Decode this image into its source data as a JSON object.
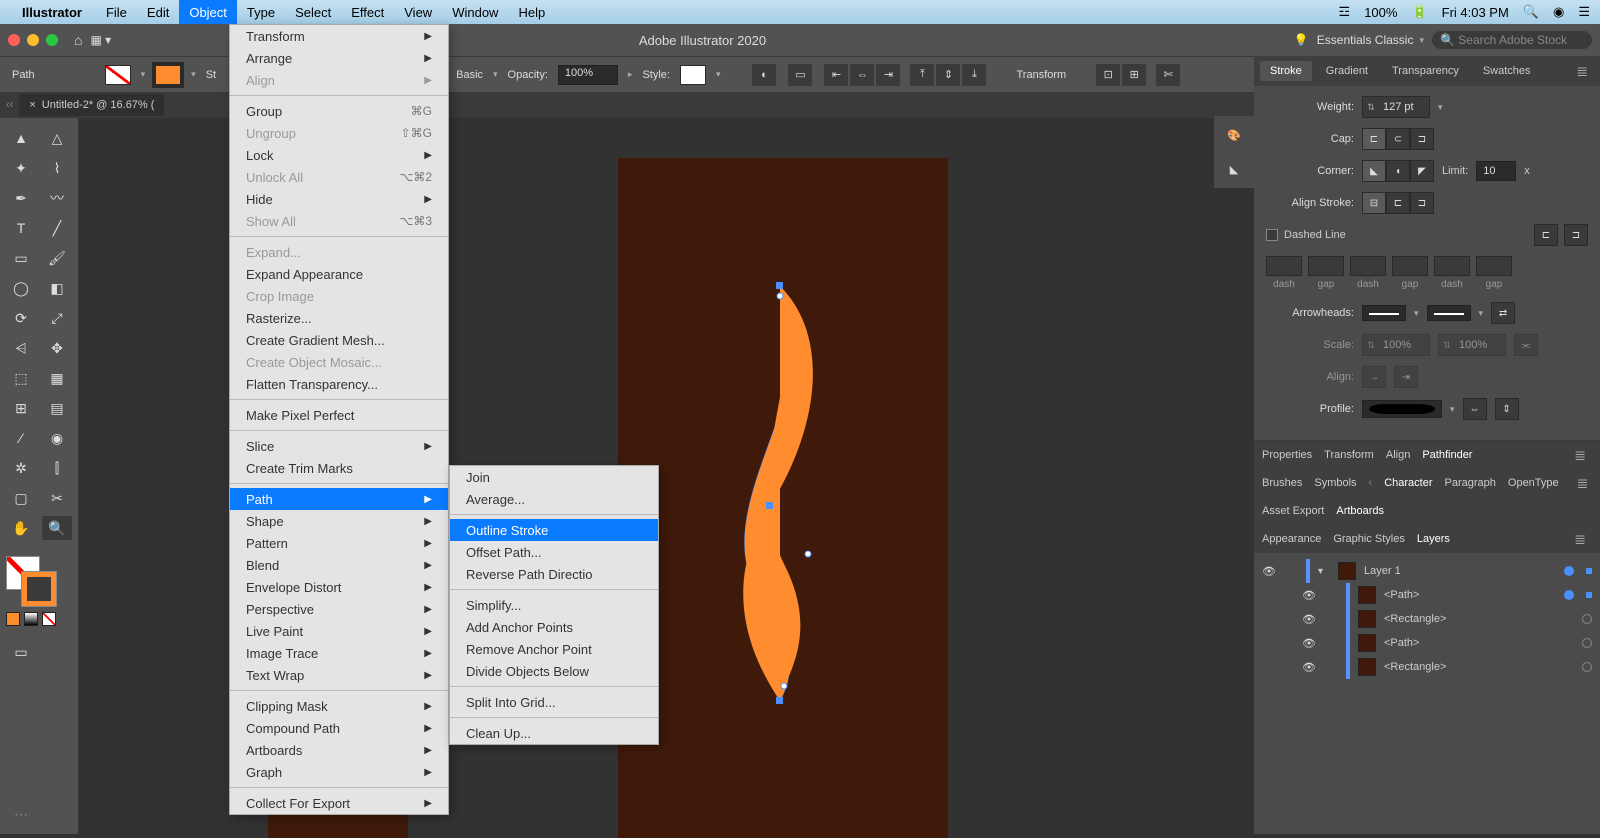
{
  "menubar": {
    "app": "Illustrator",
    "items": [
      "File",
      "Edit",
      "Object",
      "Type",
      "Select",
      "Effect",
      "View",
      "Window",
      "Help"
    ],
    "active_index": 2,
    "battery": "100%",
    "clock": "Fri 4:03 PM"
  },
  "appbar": {
    "title": "Adobe Illustrator 2020",
    "workspace": "Essentials Classic",
    "search_placeholder": "Search Adobe Stock"
  },
  "controlbar": {
    "selection_type": "Path",
    "stroke_label": "St",
    "basic_label": "Basic",
    "opacity_label": "Opacity:",
    "opacity_value": "100%",
    "style_label": "Style:",
    "transform_label": "Transform"
  },
  "tabbar": {
    "tab_title": "Untitled-2* @ 16.67% ("
  },
  "object_menu": [
    {
      "label": "Transform",
      "sub": true
    },
    {
      "label": "Arrange",
      "sub": true
    },
    {
      "label": "Align",
      "sub": true,
      "disabled": true
    },
    {
      "sep": true
    },
    {
      "label": "Group",
      "shortcut": "⌘G"
    },
    {
      "label": "Ungroup",
      "shortcut": "⇧⌘G",
      "disabled": true
    },
    {
      "label": "Lock",
      "sub": true
    },
    {
      "label": "Unlock All",
      "shortcut": "⌥⌘2",
      "disabled": true
    },
    {
      "label": "Hide",
      "sub": true
    },
    {
      "label": "Show All",
      "shortcut": "⌥⌘3",
      "disabled": true
    },
    {
      "sep": true
    },
    {
      "label": "Expand...",
      "disabled": true
    },
    {
      "label": "Expand Appearance"
    },
    {
      "label": "Crop Image",
      "disabled": true
    },
    {
      "label": "Rasterize..."
    },
    {
      "label": "Create Gradient Mesh..."
    },
    {
      "label": "Create Object Mosaic...",
      "disabled": true
    },
    {
      "label": "Flatten Transparency..."
    },
    {
      "sep": true
    },
    {
      "label": "Make Pixel Perfect"
    },
    {
      "sep": true
    },
    {
      "label": "Slice",
      "sub": true
    },
    {
      "label": "Create Trim Marks"
    },
    {
      "sep": true
    },
    {
      "label": "Path",
      "sub": true,
      "hl": true
    },
    {
      "label": "Shape",
      "sub": true
    },
    {
      "label": "Pattern",
      "sub": true
    },
    {
      "label": "Blend",
      "sub": true
    },
    {
      "label": "Envelope Distort",
      "sub": true
    },
    {
      "label": "Perspective",
      "sub": true
    },
    {
      "label": "Live Paint",
      "sub": true
    },
    {
      "label": "Image Trace",
      "sub": true
    },
    {
      "label": "Text Wrap",
      "sub": true
    },
    {
      "sep": true
    },
    {
      "label": "Clipping Mask",
      "sub": true
    },
    {
      "label": "Compound Path",
      "sub": true
    },
    {
      "label": "Artboards",
      "sub": true
    },
    {
      "label": "Graph",
      "sub": true
    },
    {
      "sep": true
    },
    {
      "label": "Collect For Export",
      "sub": true
    }
  ],
  "path_submenu": [
    {
      "label": "Join"
    },
    {
      "label": "Average..."
    },
    {
      "sep": true
    },
    {
      "label": "Outline Stroke",
      "hl": true
    },
    {
      "label": "Offset Path..."
    },
    {
      "label": "Reverse Path Directio"
    },
    {
      "sep": true
    },
    {
      "label": "Simplify..."
    },
    {
      "label": "Add Anchor Points"
    },
    {
      "label": "Remove Anchor Point"
    },
    {
      "label": "Divide Objects Below"
    },
    {
      "sep": true
    },
    {
      "label": "Split Into Grid..."
    },
    {
      "sep": true
    },
    {
      "label": "Clean Up..."
    }
  ],
  "panels": {
    "stroke_tabs": [
      "Stroke",
      "Gradient",
      "Transparency",
      "Swatches"
    ],
    "weight_label": "Weight:",
    "weight_value": "127 pt",
    "cap_label": "Cap:",
    "corner_label": "Corner:",
    "limit_label": "Limit:",
    "limit_value": "10",
    "limit_x": "x",
    "align_stroke_label": "Align Stroke:",
    "dashed_label": "Dashed Line",
    "dash_labels": [
      "dash",
      "gap",
      "dash",
      "gap",
      "dash",
      "gap"
    ],
    "arrowheads_label": "Arrowheads:",
    "scale_label": "Scale:",
    "scale_value": "100%",
    "align_label": "Align:",
    "profile_label": "Profile:",
    "sec1_tabs": [
      "Properties",
      "Transform",
      "Align",
      "Pathfinder"
    ],
    "sec2_tabs": [
      "Brushes",
      "Symbols",
      "Character",
      "Paragraph",
      "OpenType"
    ],
    "sec3_tabs": [
      "Asset Export",
      "Artboards"
    ],
    "sec4_tabs": [
      "Appearance",
      "Graphic Styles",
      "Layers"
    ],
    "layers": {
      "layer1": "Layer 1",
      "items": [
        "<Path>",
        "<Rectangle>",
        "<Path>",
        "<Rectangle>"
      ]
    }
  }
}
